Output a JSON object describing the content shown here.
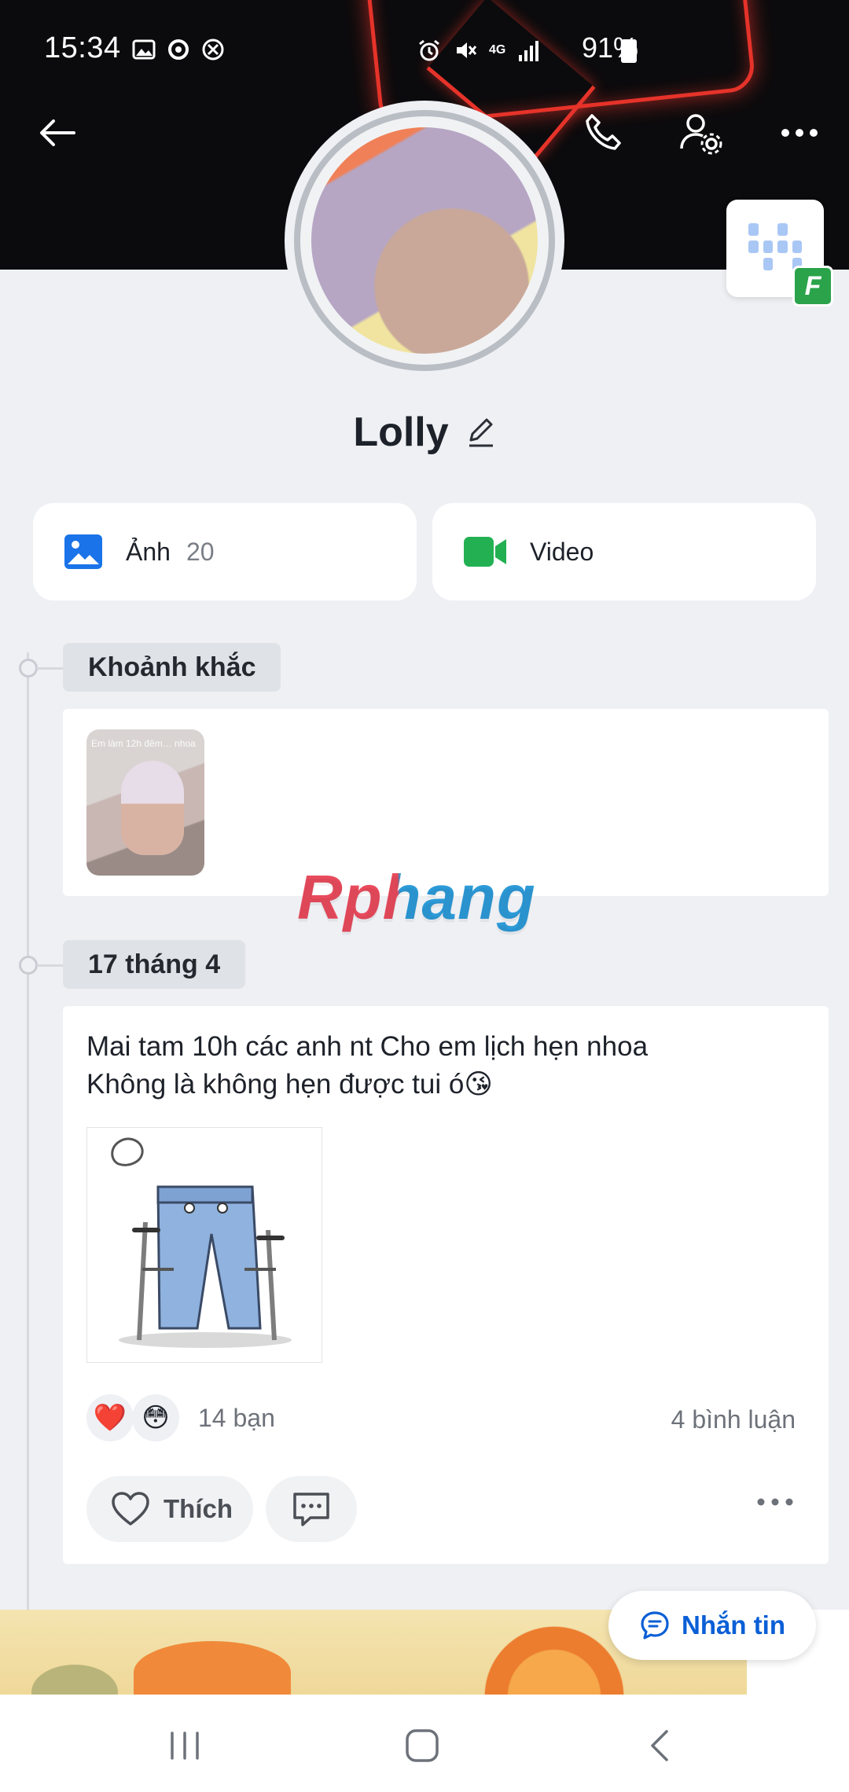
{
  "status_bar": {
    "time": "15:34",
    "battery": "91%",
    "network": "4G"
  },
  "header": {
    "back_icon": "arrow-left-icon",
    "call_icon": "phone-icon",
    "settings_icon": "user-gear-icon",
    "more_icon": "more-horizontal-icon"
  },
  "profile": {
    "name": "Lolly",
    "edit_icon": "pencil-icon"
  },
  "qr": {
    "badge_letter": "F"
  },
  "media": {
    "photos_label": "Ảnh",
    "photos_count": "20",
    "video_label": "Video"
  },
  "timeline": {
    "moments_label": "Khoảnh khắc",
    "moment_caption": "Em làm 12h đêm… nhoa",
    "date_label": "17 tháng 4"
  },
  "post": {
    "text_line1": "Mai tam 10h các anh nt Cho em lịch hẹn nhoa",
    "text_line2": "Không là không hẹn được tui ó😘",
    "reactions": [
      "❤️",
      "😳"
    ],
    "reaction_count": "14 bạn",
    "comment_count": "4 bình luận",
    "like_label": "Thích"
  },
  "watermark": "Rphang",
  "message_button": {
    "label": "Nhắn tin"
  },
  "colors": {
    "accent_blue": "#0b5fd6",
    "photo_icon_blue": "#1a73e8",
    "video_icon_green": "#23b052",
    "page_bg": "#eef0f4"
  }
}
